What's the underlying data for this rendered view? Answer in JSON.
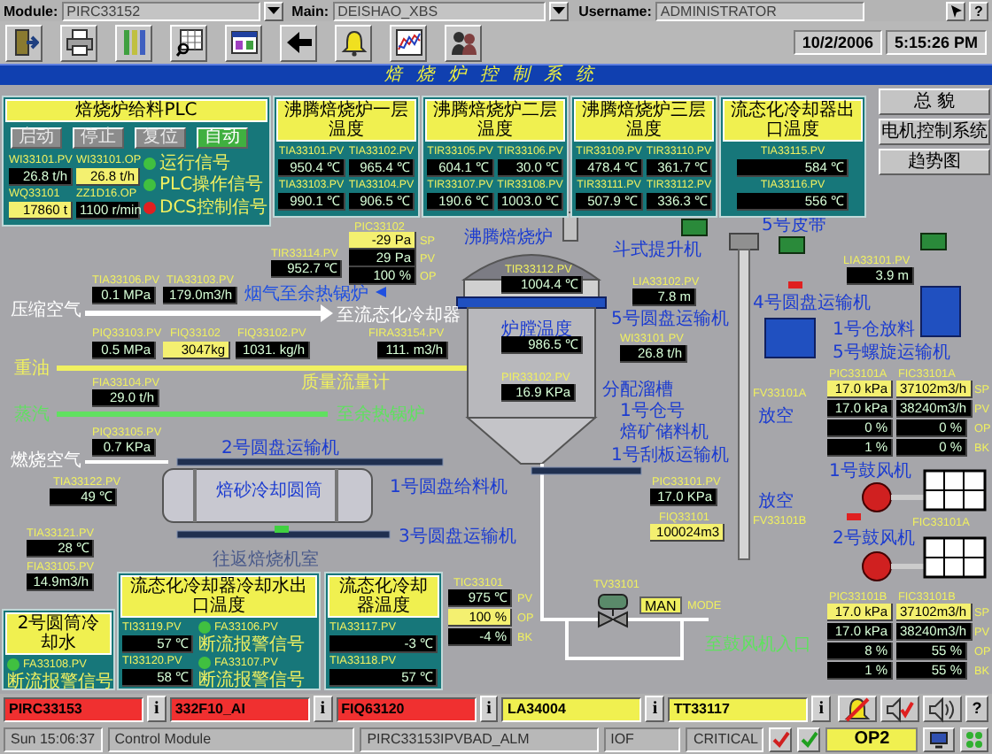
{
  "header": {
    "module_label": "Module:",
    "module": "PIRC33152",
    "main_label": "Main:",
    "main": "DEISHAO_XBS",
    "user_label": "Username:",
    "user": "ADMINISTRATOR",
    "help": "?"
  },
  "toolbar": {
    "date": "10/2/2006",
    "time": "5:15:26 PM"
  },
  "title": "焙烧炉控制系统",
  "plc_panel": {
    "title": "焙烧炉给料PLC",
    "buttons": [
      {
        "label": "启动",
        "selected": false
      },
      {
        "label": "停止",
        "selected": false
      },
      {
        "label": "复位",
        "selected": false
      },
      {
        "label": "自动",
        "selected": true
      }
    ],
    "readouts": [
      {
        "tag": "WI33101.PV",
        "value": "26.8 t/h",
        "kind": "readout"
      },
      {
        "tag": "WI33101.OP",
        "value": "26.8 t/h",
        "kind": "setpoint"
      },
      {
        "tag": "WQ33101",
        "value": "17860 t",
        "kind": "setpoint"
      },
      {
        "tag": "ZZ1D16.OP",
        "value": "1100 r/min",
        "kind": "readout"
      }
    ],
    "signals": [
      {
        "label": "运行信号",
        "color": "#40c040"
      },
      {
        "label": "PLC操作信号",
        "color": "#40c040"
      },
      {
        "label": "DCS控制信号",
        "color": "#e02020"
      }
    ]
  },
  "temp_panels": [
    {
      "title": "沸腾焙烧炉一层温度",
      "readouts": [
        {
          "tag": "TIA33101.PV",
          "value": "950.4 ℃"
        },
        {
          "tag": "TIA33102.PV",
          "value": "965.4 ℃"
        },
        {
          "tag": "TIA33103.PV",
          "value": "990.1 ℃"
        },
        {
          "tag": "TIA33104.PV",
          "value": "906.5 ℃"
        }
      ]
    },
    {
      "title": "沸腾焙烧炉二层温度",
      "readouts": [
        {
          "tag": "TIR33105.PV",
          "value": "604.1 ℃"
        },
        {
          "tag": "TIR33106.PV",
          "value": "30.0 ℃"
        },
        {
          "tag": "TIR33107.PV",
          "value": "190.6 ℃"
        },
        {
          "tag": "TIR33108.PV",
          "value": "1003.0 ℃"
        }
      ]
    },
    {
      "title": "沸腾焙烧炉三层温度",
      "readouts": [
        {
          "tag": "TIR33109.PV",
          "value": "478.4 ℃"
        },
        {
          "tag": "TIR33110.PV",
          "value": "361.7 ℃"
        },
        {
          "tag": "TIR33111.PV",
          "value": "507.9 ℃"
        },
        {
          "tag": "TIR33112.PV",
          "value": "336.3 ℃"
        }
      ]
    },
    {
      "title": "流态化冷却器出口温度",
      "readouts": [
        {
          "tag": "TIA33115.PV",
          "value": "584 ℃"
        },
        {
          "tag": "TIA33116.PV",
          "value": "556 ℃"
        }
      ]
    }
  ],
  "nav_buttons": [
    "总 貌",
    "电机控制系统",
    "趋势图"
  ],
  "canvas": {
    "items": [
      {
        "kind": "tag",
        "text": "PIC33102"
      },
      {
        "kind": "setpoint",
        "text": "-29 Pa"
      },
      {
        "kind": "tag",
        "text": "SP"
      },
      {
        "kind": "readout",
        "text": "29 Pa"
      },
      {
        "kind": "tag",
        "text": "PV"
      },
      {
        "kind": "readout",
        "text": "100 %"
      },
      {
        "kind": "tag",
        "text": "OP"
      },
      {
        "kind": "tag",
        "text": "TIR33114.PV"
      },
      {
        "kind": "readout",
        "text": "952.7 ℃"
      },
      {
        "kind": "equipment",
        "text": "沸腾焙烧炉"
      },
      {
        "kind": "tag",
        "text": "TIR33112.PV"
      },
      {
        "kind": "readout",
        "text": "1004.4 ℃"
      },
      {
        "kind": "tag",
        "text": "TIA33106.PV"
      },
      {
        "kind": "tag",
        "text": "TIA33103.PV"
      },
      {
        "kind": "readout",
        "text": "0.1 MPa"
      },
      {
        "kind": "readout",
        "text": "179.0m3/h"
      },
      {
        "kind": "pipe",
        "text": "烟气至余热锅炉",
        "color": "#2050e0"
      },
      {
        "kind": "pipe",
        "text": "压缩空气",
        "color": "#ffffff"
      },
      {
        "kind": "pipe",
        "text": "至流态化冷却器",
        "color": "#ffffff"
      },
      {
        "kind": "tag",
        "text": "PIQ33103.PV"
      },
      {
        "kind": "tag",
        "text": "FIQ33102"
      },
      {
        "kind": "tag",
        "text": "FIQ33102.PV"
      },
      {
        "kind": "tag",
        "text": "FIRA33154.PV"
      },
      {
        "kind": "readout",
        "text": "0.5 MPa"
      },
      {
        "kind": "setpoint",
        "text": "3047kg"
      },
      {
        "kind": "readout",
        "text": "1031. kg/h"
      },
      {
        "kind": "readout",
        "text": "111. m3/h"
      },
      {
        "kind": "pipe",
        "text": "重油",
        "color": "#f0f060"
      },
      {
        "kind": "tag",
        "text": "FIA33104.PV"
      },
      {
        "kind": "pipe",
        "text": "质量流量计",
        "color": "#f0f060"
      },
      {
        "kind": "readout",
        "text": "29.0 t/h"
      },
      {
        "kind": "pipe",
        "text": "蒸汽",
        "color": "#60e060"
      },
      {
        "kind": "pipe",
        "text": "至余热锅炉",
        "color": "#60e060"
      },
      {
        "kind": "tag",
        "text": "PIQ33105.PV"
      },
      {
        "kind": "readout",
        "text": "0.7 KPa"
      },
      {
        "kind": "pipe",
        "text": "燃烧空气",
        "color": "#ffffff"
      },
      {
        "kind": "tag",
        "text": "TIA33122.PV"
      },
      {
        "kind": "readout",
        "text": "49 ℃"
      },
      {
        "kind": "equipment",
        "text": "2号圆盘运输机"
      },
      {
        "kind": "equipment",
        "text": "焙砂冷却圆筒"
      },
      {
        "kind": "tag",
        "text": "TIA33121.PV"
      },
      {
        "kind": "readout",
        "text": "28 ℃"
      },
      {
        "kind": "tag",
        "text": "FIA33105.PV"
      },
      {
        "kind": "readout",
        "text": "14.9m3/h"
      },
      {
        "kind": "pipe",
        "text": "往返焙烧机室",
        "color": "#4a5a8a"
      },
      {
        "kind": "equipment",
        "text": "1号圆盘给料机"
      },
      {
        "kind": "equipment",
        "text": "3号圆盘运输机"
      },
      {
        "kind": "equipment",
        "text": "炉膛温度"
      },
      {
        "kind": "readout",
        "text": "986.5 ℃"
      },
      {
        "kind": "tag",
        "text": "PIR33102.PV"
      },
      {
        "kind": "readout",
        "text": "16.9 KPa"
      },
      {
        "kind": "equipment",
        "text": "斗式提升机"
      },
      {
        "kind": "equipment",
        "text": "5号皮带"
      },
      {
        "kind": "tag",
        "text": "LIA33101.PV"
      },
      {
        "kind": "readout",
        "text": "3.9 m"
      },
      {
        "kind": "tag",
        "text": "LIA33102.PV"
      },
      {
        "kind": "readout",
        "text": "7.8 m"
      },
      {
        "kind": "equipment",
        "text": "4号圆盘运输机"
      },
      {
        "kind": "equipment",
        "text": "5号圆盘运输机"
      },
      {
        "kind": "tag",
        "text": "WI33101.PV"
      },
      {
        "kind": "readout",
        "text": "26.8 t/h"
      },
      {
        "kind": "equipment",
        "text": "1号仓放料"
      },
      {
        "kind": "equipment",
        "text": "5号螺旋运输机"
      },
      {
        "kind": "tag",
        "text": "PIC33101A"
      },
      {
        "kind": "tag",
        "text": "FIC33101A"
      },
      {
        "kind": "setpoint",
        "text": "17.0 kPa"
      },
      {
        "kind": "setpoint",
        "text": "37102m3/h"
      },
      {
        "kind": "tag",
        "text": "SP"
      },
      {
        "kind": "readout",
        "text": "17.0 kPa"
      },
      {
        "kind": "readout",
        "text": "38240m3/h"
      },
      {
        "kind": "tag",
        "text": "PV"
      },
      {
        "kind": "readout",
        "text": "0 %"
      },
      {
        "kind": "readout",
        "text": "0 %"
      },
      {
        "kind": "tag",
        "text": "OP"
      },
      {
        "kind": "readout",
        "text": "1 %"
      },
      {
        "kind": "readout",
        "text": "0 %"
      },
      {
        "kind": "tag",
        "text": "BK"
      },
      {
        "kind": "equipment",
        "text": "分配溜槽"
      },
      {
        "kind": "equipment",
        "text": "1号仓号"
      },
      {
        "kind": "equipment",
        "text": "焙矿储料机"
      },
      {
        "kind": "equipment",
        "text": "1号刮板运输机"
      },
      {
        "kind": "tag",
        "text": "FV33101A"
      },
      {
        "kind": "equipment",
        "text": "放空"
      },
      {
        "kind": "equipment",
        "text": "1号鼓风机"
      },
      {
        "kind": "tag",
        "text": "PIC33101.PV"
      },
      {
        "kind": "readout",
        "text": "17.0 KPa"
      },
      {
        "kind": "tag",
        "text": "FIQ33101"
      },
      {
        "kind": "setpoint",
        "text": "100024m3"
      },
      {
        "kind": "equipment",
        "text": "放空"
      },
      {
        "kind": "tag",
        "text": "FV33101B"
      },
      {
        "kind": "equipment",
        "text": "2号鼓风机"
      },
      {
        "kind": "tag",
        "text": "FIC33101A"
      },
      {
        "kind": "tag",
        "text": "PIC33101B"
      },
      {
        "kind": "tag",
        "text": "FIC33101B"
      },
      {
        "kind": "setpoint",
        "text": "17.0 kPa"
      },
      {
        "kind": "setpoint",
        "text": "37102m3/h"
      },
      {
        "kind": "tag",
        "text": "SP"
      },
      {
        "kind": "readout",
        "text": "17.0 kPa"
      },
      {
        "kind": "readout",
        "text": "38240m3/h"
      },
      {
        "kind": "tag",
        "text": "PV"
      },
      {
        "kind": "readout",
        "text": "8 %"
      },
      {
        "kind": "readout",
        "text": "55 %"
      },
      {
        "kind": "tag",
        "text": "OP"
      },
      {
        "kind": "readout",
        "text": "1 %"
      },
      {
        "kind": "readout",
        "text": "55 %"
      },
      {
        "kind": "tag",
        "text": "BK"
      },
      {
        "kind": "tag",
        "text": "TIC33101"
      },
      {
        "kind": "readout",
        "text": "975 ℃"
      },
      {
        "kind": "tag",
        "text": "PV"
      },
      {
        "kind": "setpoint",
        "text": "100 %"
      },
      {
        "kind": "tag",
        "text": "OP"
      },
      {
        "kind": "readout",
        "text": "-4 %"
      },
      {
        "kind": "tag",
        "text": "BK"
      },
      {
        "kind": "tag",
        "text": "TV33101"
      },
      {
        "kind": "mode",
        "text": "MAN"
      },
      {
        "kind": "tag",
        "text": "MODE"
      },
      {
        "kind": "pipe",
        "text": "至鼓风机入口",
        "color": "#60e060"
      }
    ]
  },
  "cooling_panels": [
    {
      "title": "2号圆筒冷却水",
      "signals": [
        {
          "tag": "FA33108.PV",
          "label": "断流报警信号",
          "color": "#40c040"
        }
      ]
    },
    {
      "title": "流态化冷却器冷却水出口温度",
      "readouts": [
        {
          "tag": "TI33119.PV",
          "value": "57 ℃"
        },
        {
          "tag": "TI33120.PV",
          "value": "58 ℃"
        }
      ],
      "signals": [
        {
          "tag": "FA33106.PV",
          "label": "断流报警信号",
          "color": "#40c040"
        },
        {
          "tag": "FA33107.PV",
          "label": "断流报警信号",
          "color": "#40c040"
        }
      ]
    },
    {
      "title": "流态化冷却器温度",
      "readouts": [
        {
          "tag": "TIA33117.PV",
          "value": "-3 ℃"
        },
        {
          "tag": "TIA33118.PV",
          "value": "57 ℃"
        }
      ]
    }
  ],
  "alarms": [
    {
      "tag": "PIRC33153",
      "color": "#f03030",
      "info": "i"
    },
    {
      "tag": "332F10_AI",
      "color": "#f03030",
      "info": "i"
    },
    {
      "tag": "FIQ63120",
      "color": "#f03030",
      "info": "i"
    },
    {
      "tag": "LA34004",
      "color": "#f0f050",
      "info": "i"
    },
    {
      "tag": "TT33117",
      "color": "#f0f050",
      "info": "i"
    }
  ],
  "alarm_help": "?",
  "status_bar": {
    "time": "Sun 15:06:37",
    "module": "Control Module",
    "alarm": "PIRC33153IPVBAD_ALM",
    "type": "IOF",
    "priority": "CRITICAL",
    "operator": "OP2"
  }
}
